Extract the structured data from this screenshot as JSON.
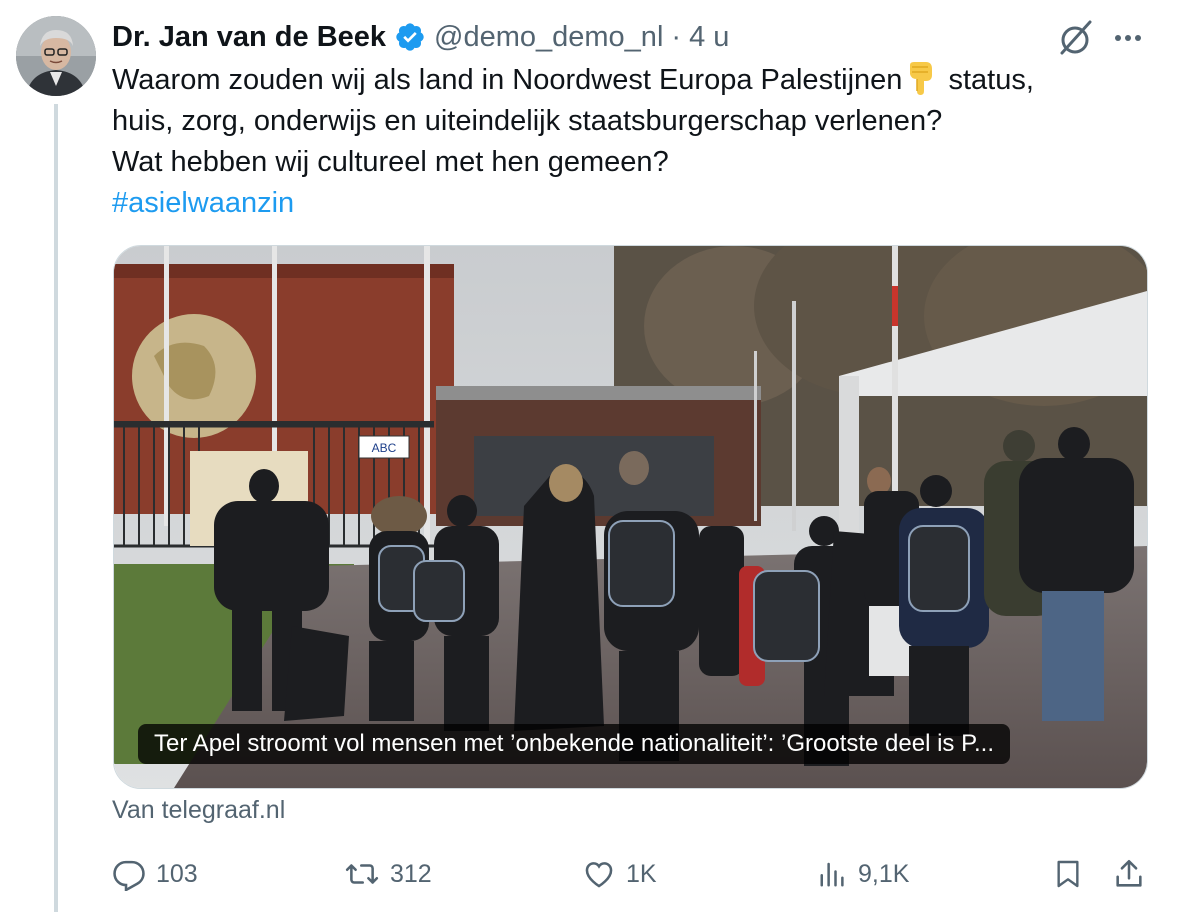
{
  "tweet": {
    "author": {
      "display_name": "Dr. Jan van de Beek",
      "handle": "@demo_demo_nl",
      "time_ago": "4 u",
      "verified": true
    },
    "text_part1": "Waarom zouden wij als land in Noordwest Europa Palestijnen",
    "emoji": "point-down-emoji",
    "text_part2": " status,\nhuis, zorg, onderwijs en uiteindelijk staatsburgerschap verlenen?\nWat hebben wij cultureel met hen gemeen?\n",
    "hashtag": "#asielwaanzin",
    "card": {
      "caption": "Ter Apel stroomt vol mensen met ’onbekende nationaliteit’: ’Grootste deel is P...",
      "sign_text": "ABC"
    },
    "source": "Van telegraaf.nl",
    "actions": {
      "replies": "103",
      "retweets": "312",
      "likes": "1K",
      "views": "9,1K"
    }
  },
  "colors": {
    "text": "#0f1419",
    "secondary": "#536471",
    "link": "#1d9bf0",
    "verified_badge": "#1d9bf0",
    "thread_line": "#cfd9de"
  },
  "icons": [
    "verified-icon",
    "grok-icon",
    "more-icon",
    "reply-icon",
    "retweet-icon",
    "like-icon",
    "views-icon",
    "bookmark-icon",
    "share-icon"
  ]
}
